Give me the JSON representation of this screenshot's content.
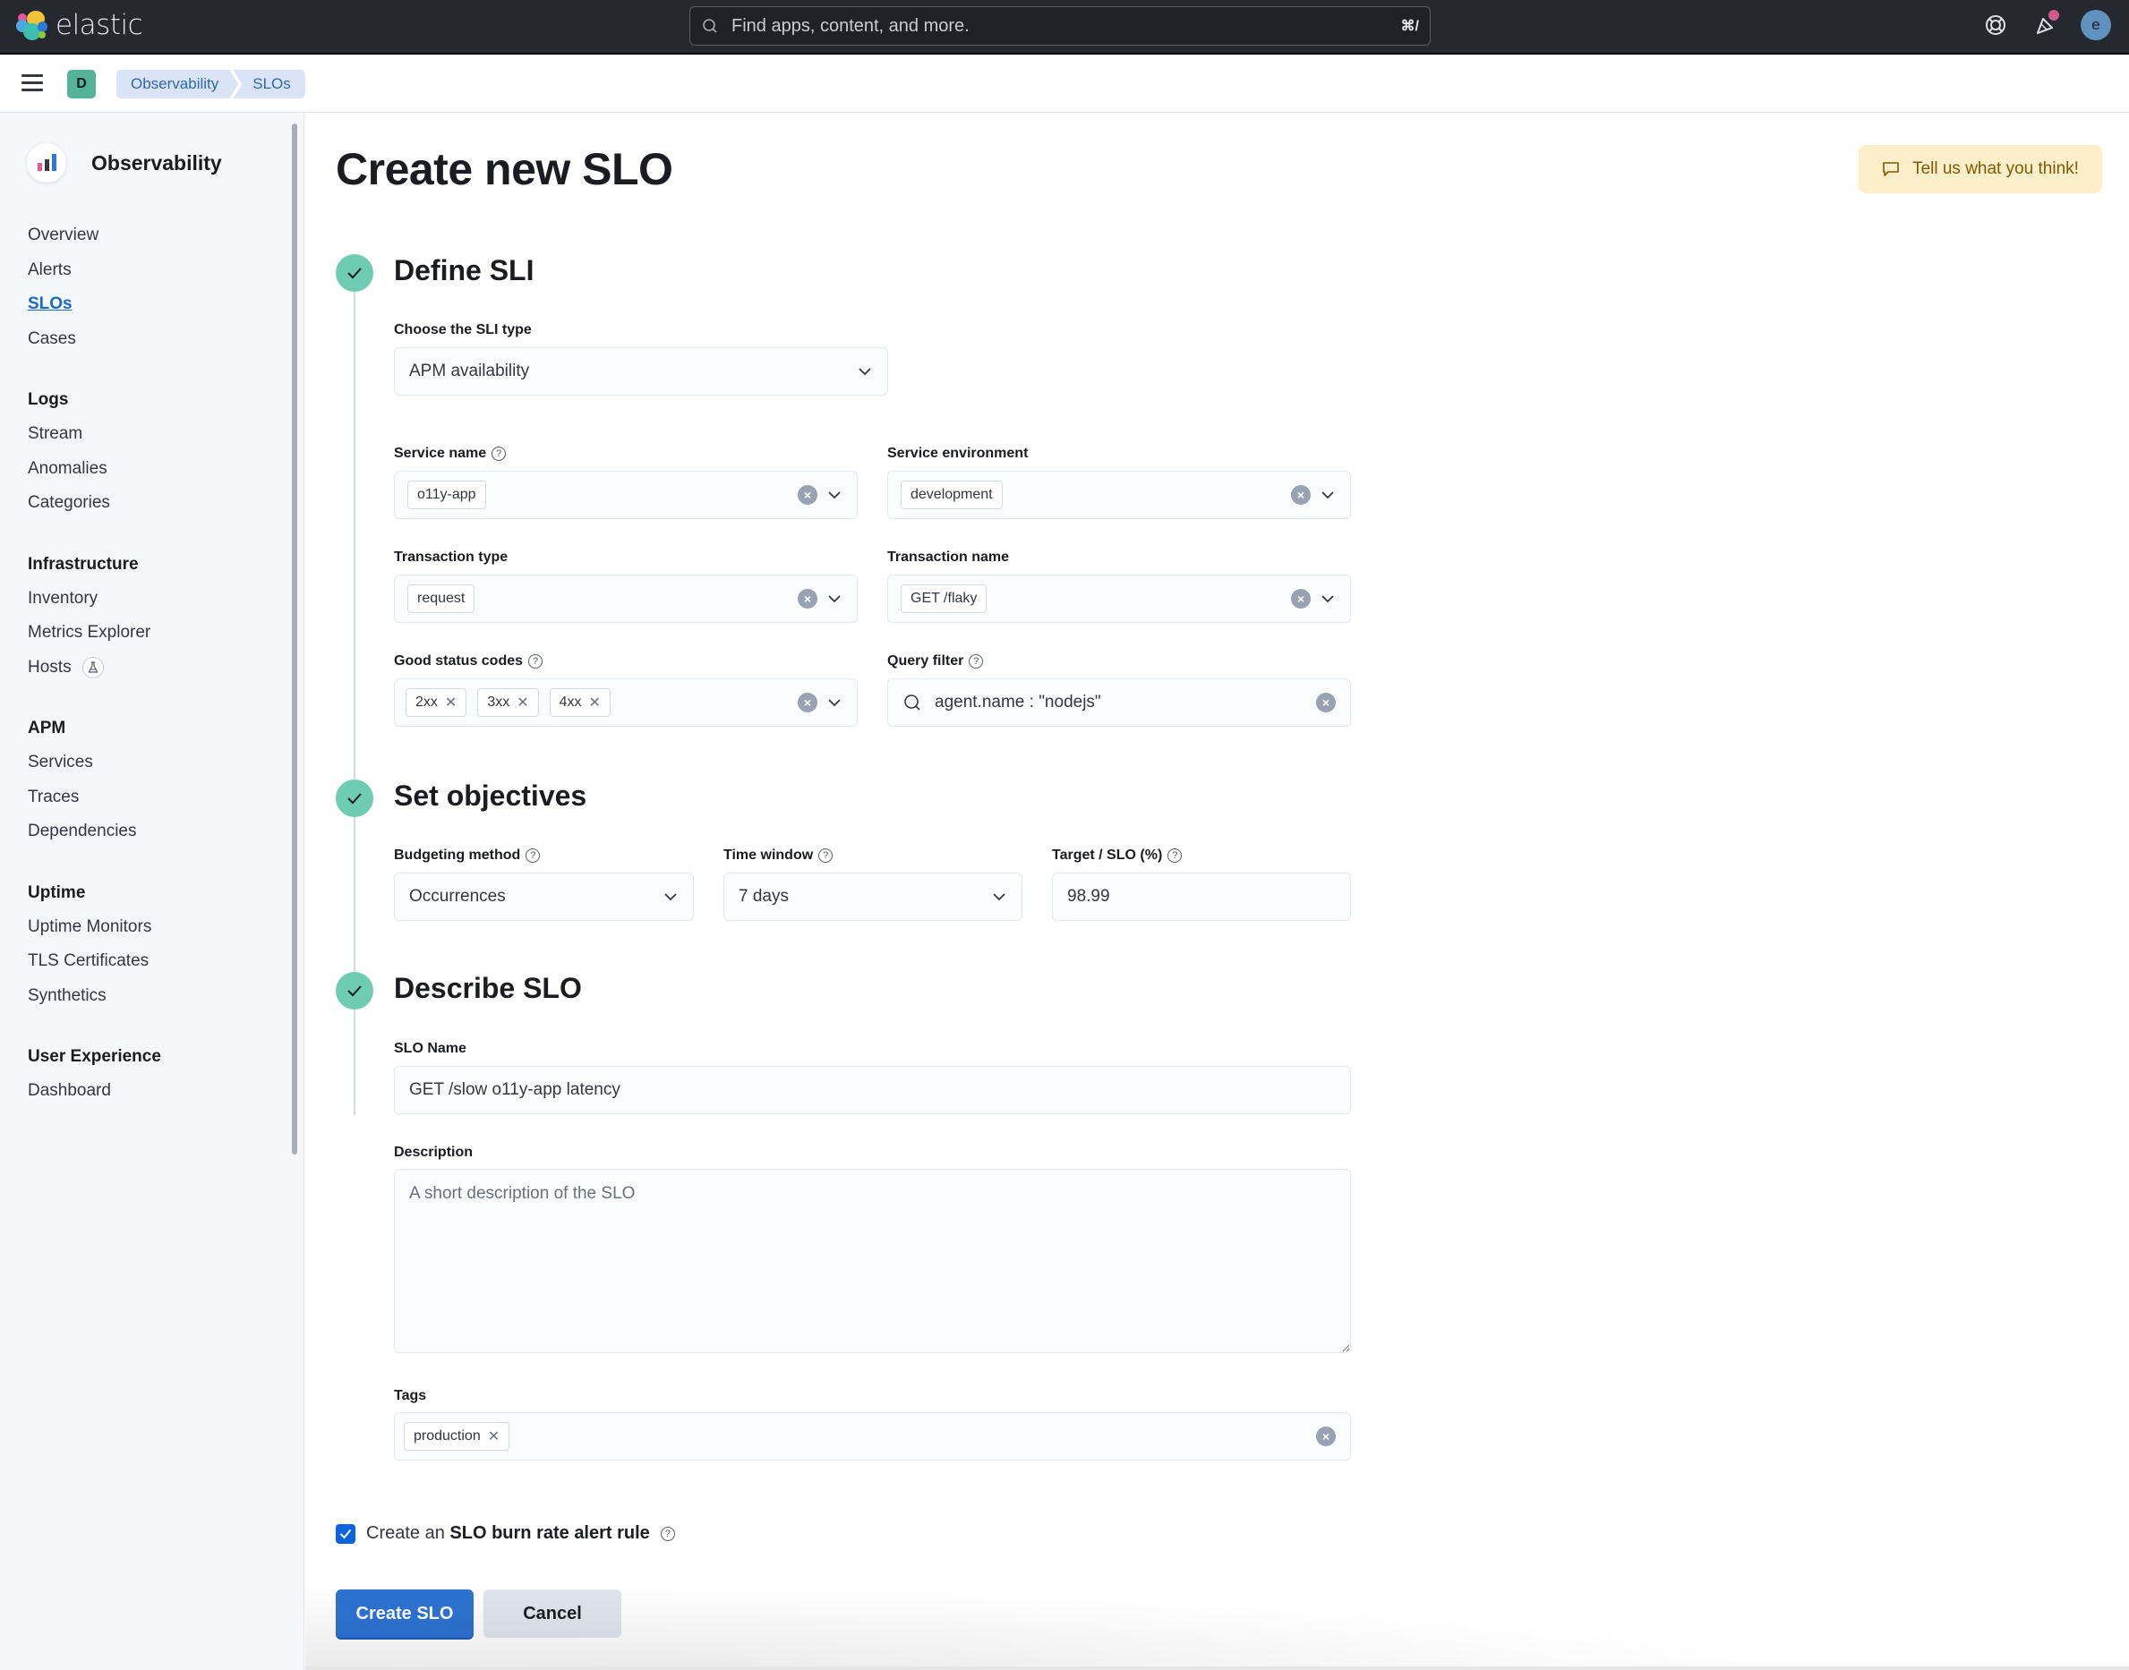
{
  "app": {
    "brand": "elastic",
    "search_placeholder": "Find apps, content, and more.",
    "search_shortcut": "⌘/",
    "user_initial": "e"
  },
  "breadcrumb": {
    "space_initial": "D",
    "items": [
      "Observability",
      "SLOs"
    ]
  },
  "sidebar": {
    "title": "Observability",
    "groups": [
      {
        "title": "",
        "items": [
          {
            "label": "Overview",
            "active": false
          },
          {
            "label": "Alerts",
            "active": false
          },
          {
            "label": "SLOs",
            "active": true
          },
          {
            "label": "Cases",
            "active": false
          }
        ]
      },
      {
        "title": "Logs",
        "items": [
          {
            "label": "Stream"
          },
          {
            "label": "Anomalies"
          },
          {
            "label": "Categories"
          }
        ]
      },
      {
        "title": "Infrastructure",
        "items": [
          {
            "label": "Inventory"
          },
          {
            "label": "Metrics Explorer"
          },
          {
            "label": "Hosts",
            "badge": "beta-flask-icon"
          }
        ]
      },
      {
        "title": "APM",
        "items": [
          {
            "label": "Services"
          },
          {
            "label": "Traces"
          },
          {
            "label": "Dependencies"
          }
        ]
      },
      {
        "title": "Uptime",
        "items": [
          {
            "label": "Uptime Monitors"
          },
          {
            "label": "TLS Certificates"
          },
          {
            "label": "Synthetics"
          }
        ]
      },
      {
        "title": "User Experience",
        "items": [
          {
            "label": "Dashboard"
          }
        ]
      }
    ]
  },
  "page": {
    "title": "Create new SLO",
    "feedback_label": "Tell us what you think!"
  },
  "steps": {
    "define": {
      "title": "Define SLI",
      "sli_type_label": "Choose the SLI type",
      "sli_type_value": "APM availability",
      "service_name_label": "Service name",
      "service_name_value": "o11y-app",
      "service_env_label": "Service environment",
      "service_env_value": "development",
      "tx_type_label": "Transaction type",
      "tx_type_value": "request",
      "tx_name_label": "Transaction name",
      "tx_name_value": "GET /flaky",
      "good_codes_label": "Good status codes",
      "good_codes": [
        "2xx",
        "3xx",
        "4xx"
      ],
      "query_filter_label": "Query filter",
      "query_filter_value": "agent.name : \"nodejs\""
    },
    "objectives": {
      "title": "Set objectives",
      "budgeting_label": "Budgeting method",
      "budgeting_value": "Occurrences",
      "time_window_label": "Time window",
      "time_window_value": "7 days",
      "target_label": "Target / SLO (%)",
      "target_value": "98.99"
    },
    "describe": {
      "title": "Describe SLO",
      "name_label": "SLO Name",
      "name_value": "GET /slow o11y-app latency",
      "description_label": "Description",
      "description_placeholder": "A short description of the SLO",
      "tags_label": "Tags",
      "tags": [
        "production"
      ]
    }
  },
  "alert_rule": {
    "checked": true,
    "prefix": "Create an",
    "bold": "SLO burn rate alert rule"
  },
  "actions": {
    "create_label": "Create SLO",
    "cancel_label": "Cancel"
  },
  "colors": {
    "accent": "#2d72d2",
    "step_complete": "#6dccb1",
    "header_bg": "#25282f",
    "breadcrumb_bg": "#d9e5f6",
    "feedback_bg": "#fcefc9"
  }
}
